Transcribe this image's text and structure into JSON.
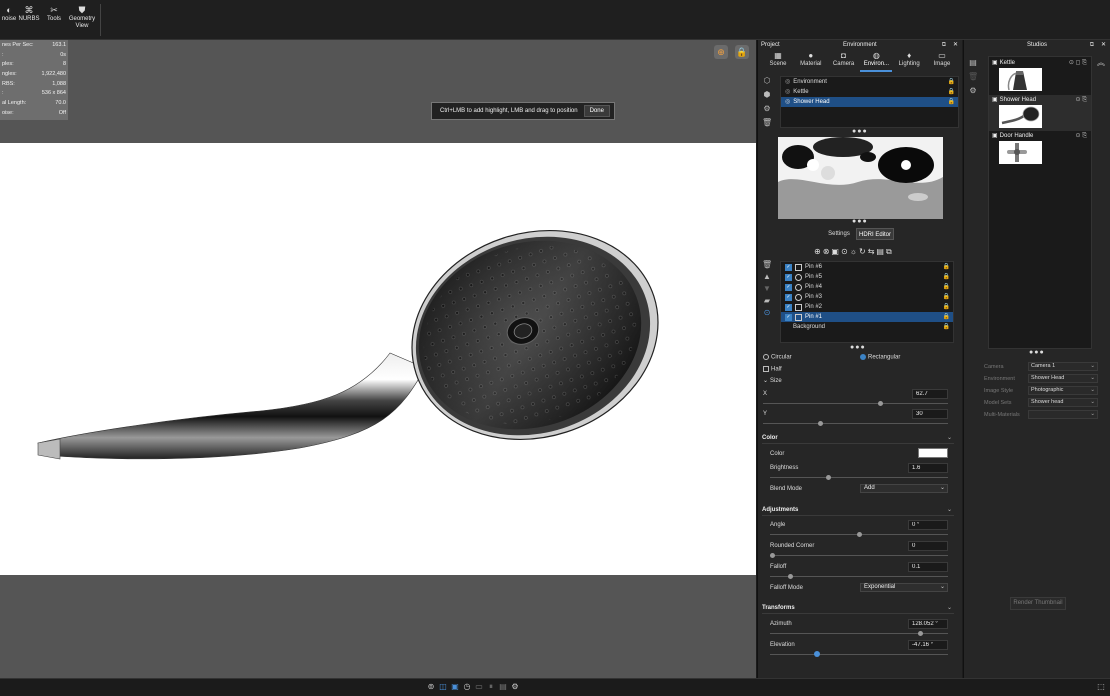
{
  "toolbar": {
    "buttons": [
      {
        "label": "noise",
        "icon": "denoise-icon"
      },
      {
        "label": "NURBS",
        "icon": "nurbs-icon"
      },
      {
        "label": "Tools",
        "icon": "tools-icon"
      },
      {
        "label": "Geometry View",
        "icon": "geometry-view-icon"
      }
    ]
  },
  "stats": {
    "rows": [
      {
        "label": "nes Per Sec:",
        "value": "163.1"
      },
      {
        "label": ":",
        "value": "0s"
      },
      {
        "label": "ples:",
        "value": "8"
      },
      {
        "label": "ngles:",
        "value": "1,922,480"
      },
      {
        "label": "RBS:",
        "value": "1,088"
      },
      {
        "label": ":",
        "value": "536 x 864"
      },
      {
        "label": "al Length:",
        "value": "70.0"
      },
      {
        "label": "oise:",
        "value": "Off"
      }
    ]
  },
  "hint": {
    "text": "Ctrl+LMB to add highlight, LMB and drag to position",
    "done_label": "Done"
  },
  "project": {
    "title": "Project",
    "section_title": "Environment",
    "tabs": [
      "Scene",
      "Material",
      "Camera",
      "Environ...",
      "Lighting",
      "Image"
    ],
    "environments": [
      "Environment",
      "Kettle",
      "Shower Head"
    ],
    "subtabs": [
      "Settings",
      "HDRI Editor"
    ],
    "pins": [
      "Pin #6",
      "Pin #5",
      "Pin #4",
      "Pin #3",
      "Pin #2",
      "Pin #1"
    ],
    "background_label": "Background",
    "shape": {
      "circular": "Circular",
      "rectangular": "Rectangular",
      "half": "Half",
      "size": "Size"
    },
    "size": {
      "x_label": "X",
      "x_value": "62.7",
      "y_label": "Y",
      "y_value": "30"
    },
    "color_section": {
      "title": "Color",
      "color_label": "Color",
      "brightness_label": "Brightness",
      "brightness_value": "1.6",
      "blend_label": "Blend Mode",
      "blend_value": "Add"
    },
    "adjustments": {
      "title": "Adjustments",
      "angle_label": "Angle",
      "angle_value": "0 °",
      "rounded_label": "Rounded Corner",
      "rounded_value": "0",
      "falloff_label": "Falloff",
      "falloff_value": "0.1",
      "falloff_mode_label": "Falloff Mode",
      "falloff_mode_value": "Exponential"
    },
    "transforms": {
      "title": "Transforms",
      "azimuth_label": "Azimuth",
      "azimuth_value": "128.052 °",
      "elevation_label": "Elevation",
      "elevation_value": "-47.16 °"
    }
  },
  "studios": {
    "title": "Studios",
    "items": [
      "Kettle",
      "Shower Head",
      "Door Handle"
    ],
    "props": [
      {
        "label": "Camera",
        "value": "Camera 1"
      },
      {
        "label": "Environment",
        "value": "Shower Head"
      },
      {
        "label": "Image Style",
        "value": "Photographic"
      },
      {
        "label": "Model Sets",
        "value": "Shower head"
      },
      {
        "label": "Multi-Materials",
        "value": ""
      }
    ],
    "render_button": "Render Thumbnail"
  }
}
